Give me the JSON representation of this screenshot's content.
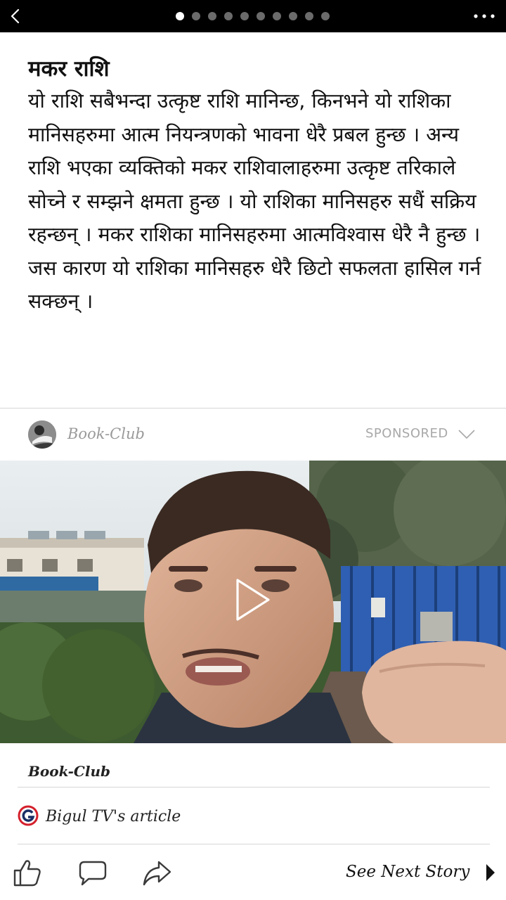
{
  "article": {
    "title": "मकर राशि",
    "body": "यो राशि सबैभन्दा उत्कृष्ट राशि मानिन्छ, किनभने यो राशिका मानिसहरुमा आत्म नियन्त्रणको भावना धेरै प्रबल हुन्छ । अन्य राशि भएका व्यक्तिको मकर राशिवालाहरुमा उत्कृष्ट तरिकाले सोच्ने र सम्झने क्षमता हुन्छ । यो राशिका मानिसहरु सधैं सक्रिय रहन्छन् । मकर राशिका मानिसहरुमा आत्मविश्वास धेरै नै हुन्छ । जस कारण यो राशिका मानिसहरु धेरै छिटो सफलता हासिल गर्न सक्छन् ।"
  },
  "pager": {
    "total": 10,
    "current": 1
  },
  "ad": {
    "brand": "Book-Club",
    "sponsored_label": "SPONSORED",
    "caption": "Book-Club"
  },
  "source": {
    "label": "Bigul TV's article"
  },
  "actions": {
    "next_label": "See Next Story"
  },
  "colors": {
    "topbar": "#000000",
    "divider": "#d6d6d6",
    "muted": "#9a9a9a"
  },
  "icons": [
    "back-icon",
    "more-icon",
    "chevron-down-icon",
    "play-icon",
    "bigul-logo-icon",
    "like-icon",
    "comment-icon",
    "share-icon",
    "next-arrow-icon"
  ]
}
